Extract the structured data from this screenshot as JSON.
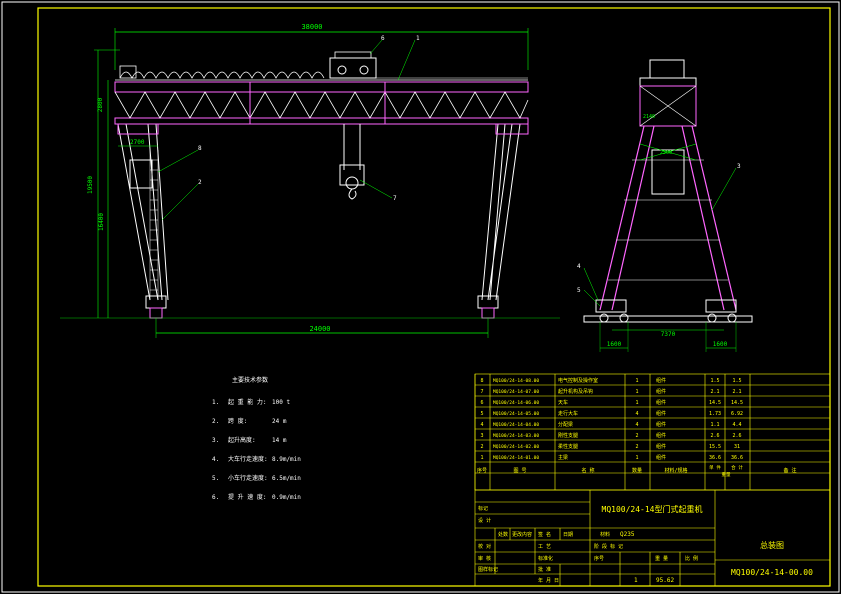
{
  "front_view": {
    "dim_top": "38000",
    "dim_height_upper": "2800",
    "dim_height_total": "19500",
    "dim_leg_height": "16400",
    "dim_cab": "2700",
    "dim_span": "24000",
    "callouts": [
      "6",
      "1",
      "8",
      "2",
      "7"
    ]
  },
  "side_view": {
    "callouts": [
      "3",
      "4",
      "5"
    ],
    "dim_base": "7370",
    "dim_left": "1600",
    "dim_right": "1600",
    "label_top": "2140",
    "label_mid": "2500"
  },
  "params": {
    "title": "主要技术参数",
    "rows": [
      {
        "n": "1.",
        "label": "起 重 能 力:",
        "value": "100 t"
      },
      {
        "n": "2.",
        "label": "跨     度:",
        "value": "24 m"
      },
      {
        "n": "3.",
        "label": "起升高度:",
        "value": "14 m"
      },
      {
        "n": "4.",
        "label": "大车行走速度:",
        "value": "8.9m/min"
      },
      {
        "n": "5.",
        "label": "小车行走速度:",
        "value": "6.5m/min"
      },
      {
        "n": "6.",
        "label": "提 升 速 度:",
        "value": "0.9m/min"
      }
    ]
  },
  "bom": {
    "rows": [
      {
        "no": "8",
        "code": "MQ100/24-14-08.00",
        "name": "电气控制及操作室",
        "qty": "1",
        "mat": "组件",
        "w1": "1.5",
        "w2": "1.5"
      },
      {
        "no": "7",
        "code": "MQ100/24-14-07.00",
        "name": "起升机构及吊钩",
        "qty": "1",
        "mat": "组件",
        "w1": "2.1",
        "w2": "2.1"
      },
      {
        "no": "6",
        "code": "MQ100/24-14-06.00",
        "name": "天车",
        "qty": "1",
        "mat": "组件",
        "w1": "14.5",
        "w2": "14.5"
      },
      {
        "no": "5",
        "code": "MQ100/24-14-05.00",
        "name": "走行大车",
        "qty": "4",
        "mat": "组件",
        "w1": "1.73",
        "w2": "6.92"
      },
      {
        "no": "4",
        "code": "MQ100/24-14-04.00",
        "name": "分配梁",
        "qty": "4",
        "mat": "组件",
        "w1": "1.1",
        "w2": "4.4"
      },
      {
        "no": "3",
        "code": "MQ100/24-14-03.00",
        "name": "刚性支腿",
        "qty": "2",
        "mat": "组件",
        "w1": "2.6",
        "w2": "2.6"
      },
      {
        "no": "2",
        "code": "MQ100/24-14-02.00",
        "name": "柔性支腿",
        "qty": "2",
        "mat": "组件",
        "w1": "15.5",
        "w2": "31"
      },
      {
        "no": "1",
        "code": "MQ100/24-14-01.00",
        "name": "主梁",
        "qty": "1",
        "mat": "组件",
        "w1": "36.6",
        "w2": "36.6"
      }
    ],
    "header": {
      "no": "序号",
      "code": "图    号",
      "name": "名    称",
      "qty": "数量",
      "mat": "材料/规格",
      "w1": "单 件",
      "w2": "合 计",
      "weight": "重量",
      "remark": "备 注"
    }
  },
  "title_block": {
    "drawing_title": "MQ100/24-14型门式起重机",
    "view_name": "总装图",
    "drawing_no": "MQ100/24-14-00.00",
    "material": "Q235",
    "material_label": "材料",
    "labels": {
      "mark": "标记",
      "design": "设 计",
      "process": "处数",
      "change": "更改内容",
      "sign": "签 名",
      "date": "日期",
      "check": "校 对",
      "craft": "工 艺",
      "review": "审 核",
      "std": "标准化",
      "approve": "批 准",
      "stage": "阶 段 标 记",
      "weight": "重 量",
      "scale": "比 例",
      "sheet": "共 张",
      "page": "第 张",
      "ymd": "年 月 日",
      "orderno": "图样标记",
      "seq": "序号"
    },
    "qty_val": "1",
    "weight_val": "95.62"
  }
}
